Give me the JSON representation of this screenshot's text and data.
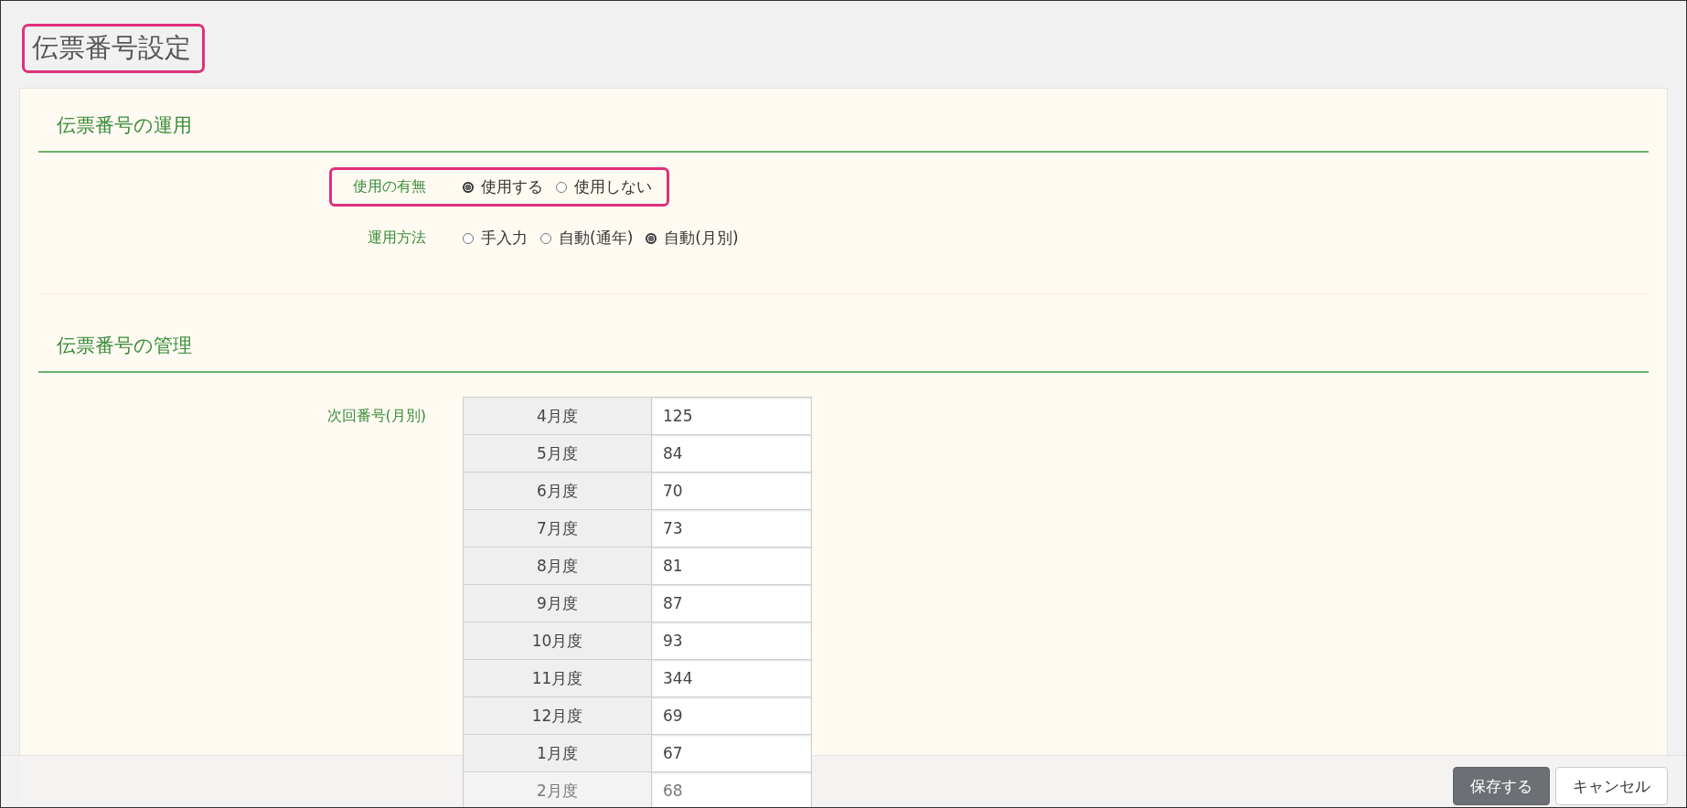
{
  "title": {
    "text": "伝票番号設定",
    "highlighted": true
  },
  "sections": [
    {
      "heading": "伝票番号の運用",
      "rows": [
        {
          "kind": "radio",
          "label": "使用の有無",
          "highlighted": true,
          "options": [
            {
              "label": "使用する",
              "selected": true
            },
            {
              "label": "使用しない",
              "selected": false
            }
          ]
        },
        {
          "kind": "radio",
          "label": "運用方法",
          "highlighted": false,
          "options": [
            {
              "label": "手入力",
              "selected": false
            },
            {
              "label": "自動(通年)",
              "selected": false
            },
            {
              "label": "自動(月別)",
              "selected": true
            }
          ]
        }
      ]
    },
    {
      "heading": "伝票番号の管理",
      "rows": [
        {
          "kind": "table",
          "label": "次回番号(月別)",
          "highlighted": false,
          "entries": [
            {
              "month": "4月度",
              "value": "125"
            },
            {
              "month": "5月度",
              "value": "84"
            },
            {
              "month": "6月度",
              "value": "70"
            },
            {
              "month": "7月度",
              "value": "73"
            },
            {
              "month": "8月度",
              "value": "81"
            },
            {
              "month": "9月度",
              "value": "87"
            },
            {
              "month": "10月度",
              "value": "93"
            },
            {
              "month": "11月度",
              "value": "344"
            },
            {
              "month": "12月度",
              "value": "69"
            },
            {
              "month": "1月度",
              "value": "67"
            },
            {
              "month": "2月度",
              "value": "68"
            }
          ]
        }
      ]
    }
  ],
  "buttons": [
    {
      "label": "保存する",
      "kind": "primary"
    },
    {
      "label": "キャンセル",
      "kind": "secondary"
    }
  ]
}
